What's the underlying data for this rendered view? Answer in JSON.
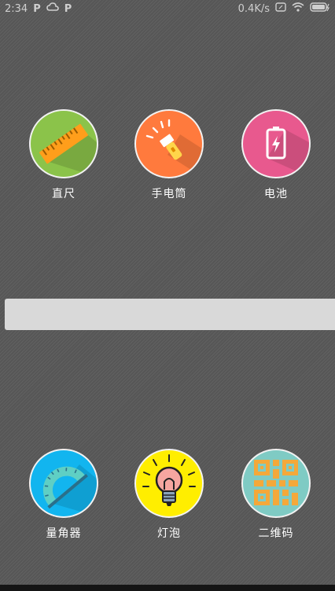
{
  "status_bar": {
    "time": "2:34",
    "left_icons": [
      "P",
      "cloud-icon",
      "P"
    ],
    "net_speed": "0.4K/s"
  },
  "tools_top": [
    {
      "label": "直尺",
      "icon": "ruler-icon",
      "color": "#8bc34a"
    },
    {
      "label": "手电筒",
      "icon": "flashlight-icon",
      "color": "#ff7a3d"
    },
    {
      "label": "电池",
      "icon": "battery-icon",
      "color": "#e8598e"
    }
  ],
  "tools_bottom": [
    {
      "label": "量角器",
      "icon": "protractor-icon",
      "color": "#12b5ef"
    },
    {
      "label": "灯泡",
      "icon": "lightbulb-icon",
      "color": "#ffee00"
    },
    {
      "label": "二维码",
      "icon": "qr-code-icon",
      "color": "#7fcbc4"
    }
  ],
  "colors": {
    "background": "#5b5b5b",
    "bar": "#d9d9d9"
  }
}
